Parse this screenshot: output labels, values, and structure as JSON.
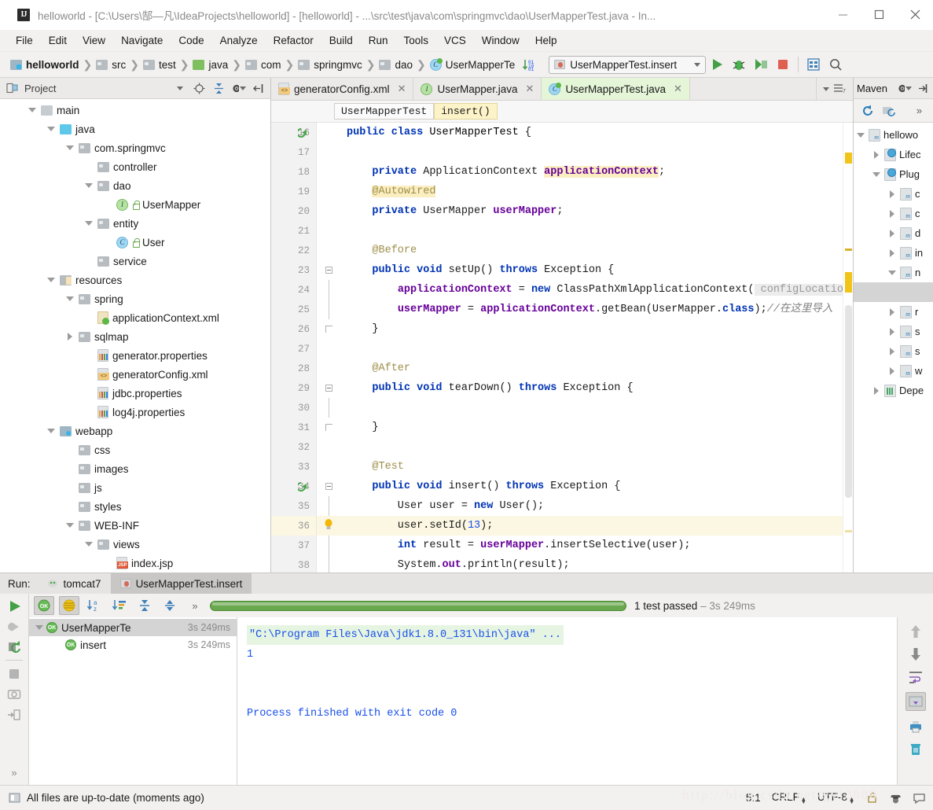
{
  "window": {
    "title": "helloworld - [C:\\Users\\郜—凡\\IdeaProjects\\helloworld] - [helloworld] - ...\\src\\test\\java\\com\\springmvc\\dao\\UserMapperTest.java - In...",
    "app_icon": "IJ",
    "minimize": "minimize-icon",
    "maximize": "maximize-icon",
    "close": "close-icon"
  },
  "menubar": {
    "items": [
      "File",
      "Edit",
      "View",
      "Navigate",
      "Code",
      "Analyze",
      "Refactor",
      "Build",
      "Run",
      "Tools",
      "VCS",
      "Window",
      "Help"
    ]
  },
  "navbar": {
    "breadcrumbs": [
      {
        "label": "helloworld",
        "icon": "module-folder-icon"
      },
      {
        "label": "src",
        "icon": "folder-icon"
      },
      {
        "label": "test",
        "icon": "folder-icon"
      },
      {
        "label": "java",
        "icon": "source-root-folder-icon"
      },
      {
        "label": "com",
        "icon": "package-icon"
      },
      {
        "label": "springmvc",
        "icon": "package-icon"
      },
      {
        "label": "dao",
        "icon": "package-icon"
      },
      {
        "label": "UserMapperTe",
        "icon": "test-class-icon"
      }
    ],
    "run_config": "UserMapperTest.insert",
    "buttons": [
      "run-button",
      "debug-button",
      "run-with-coverage-button",
      "stop-button",
      "layout-button",
      "search-button"
    ]
  },
  "project_panel": {
    "title": "Project",
    "tools": [
      "collapse-dropdown-icon",
      "locate-icon",
      "collapse-all-icon",
      "settings-gear-icon",
      "hide-panel-icon"
    ],
    "tree": [
      {
        "label": "main",
        "depth": 2,
        "arrow": "down",
        "icon": "folder-grey"
      },
      {
        "label": "java",
        "depth": 3,
        "arrow": "down",
        "icon": "folder-source"
      },
      {
        "label": "com.springmvc",
        "depth": 4,
        "arrow": "down",
        "icon": "package"
      },
      {
        "label": "controller",
        "depth": 5,
        "arrow": "none",
        "icon": "package"
      },
      {
        "label": "dao",
        "depth": 5,
        "arrow": "down",
        "icon": "package"
      },
      {
        "label": "UserMapper",
        "depth": 6,
        "arrow": "none",
        "icon": "interface"
      },
      {
        "label": "entity",
        "depth": 5,
        "arrow": "down",
        "icon": "package"
      },
      {
        "label": "User",
        "depth": 6,
        "arrow": "none",
        "icon": "class"
      },
      {
        "label": "service",
        "depth": 5,
        "arrow": "none",
        "icon": "package"
      },
      {
        "label": "resources",
        "depth": 3,
        "arrow": "down",
        "icon": "resources"
      },
      {
        "label": "spring",
        "depth": 4,
        "arrow": "down",
        "icon": "package"
      },
      {
        "label": "applicationContext.xml",
        "depth": 5,
        "arrow": "none",
        "icon": "spring-xml"
      },
      {
        "label": "sqlmap",
        "depth": 4,
        "arrow": "right",
        "icon": "package"
      },
      {
        "label": "generator.properties",
        "depth": 5,
        "arrow": "none",
        "icon": "properties"
      },
      {
        "label": "generatorConfig.xml",
        "depth": 5,
        "arrow": "none",
        "icon": "xml"
      },
      {
        "label": "jdbc.properties",
        "depth": 5,
        "arrow": "none",
        "icon": "properties"
      },
      {
        "label": "log4j.properties",
        "depth": 5,
        "arrow": "none",
        "icon": "properties"
      },
      {
        "label": "webapp",
        "depth": 3,
        "arrow": "down",
        "icon": "folder-web"
      },
      {
        "label": "css",
        "depth": 4,
        "arrow": "none",
        "icon": "folder-plain"
      },
      {
        "label": "images",
        "depth": 4,
        "arrow": "none",
        "icon": "folder-plain"
      },
      {
        "label": "js",
        "depth": 4,
        "arrow": "none",
        "icon": "folder-plain"
      },
      {
        "label": "styles",
        "depth": 4,
        "arrow": "none",
        "icon": "folder-plain"
      },
      {
        "label": "WEB-INF",
        "depth": 4,
        "arrow": "down",
        "icon": "folder-plain"
      },
      {
        "label": "views",
        "depth": 5,
        "arrow": "down",
        "icon": "folder-plain"
      },
      {
        "label": "index.jsp",
        "depth": 6,
        "arrow": "none",
        "icon": "jsp"
      }
    ]
  },
  "editor": {
    "tabs": [
      {
        "label": "generatorConfig.xml",
        "icon": "xml-file-icon",
        "active": false
      },
      {
        "label": "UserMapper.java",
        "icon": "interface-icon",
        "active": false
      },
      {
        "label": "UserMapperTest.java",
        "icon": "test-class-icon",
        "active": true
      }
    ],
    "tab_tools": [
      "tab-list-dropdown-icon"
    ],
    "breadcrumbs": [
      {
        "label": "UserMapperTest",
        "highlighted": false
      },
      {
        "label": "insert()",
        "highlighted": true
      }
    ],
    "first_line": 16,
    "lines": [
      {
        "num": 16,
        "html": "<span class=\"kw\">public class</span> <span class=\"ty\">UserMapperTest</span> {",
        "fold": "none",
        "mark": "runarrow",
        "hl": false
      },
      {
        "num": 17,
        "html": "",
        "fold": "none",
        "mark": "",
        "hl": false
      },
      {
        "num": 18,
        "html": "    <span class=\"kw\">private</span> ApplicationContext <span class=\"fld hlbg\">applicationContext</span>;",
        "fold": "none",
        "mark": "",
        "hl": false
      },
      {
        "num": 19,
        "html": "    <span class=\"an hlbg\">@Autowired</span>",
        "fold": "none",
        "mark": "",
        "hl": false
      },
      {
        "num": 20,
        "html": "    <span class=\"kw\">private</span> UserMapper <span class=\"fld\">userMapper</span>;",
        "fold": "none",
        "mark": "",
        "hl": false
      },
      {
        "num": 21,
        "html": "",
        "fold": "none",
        "mark": "",
        "hl": false
      },
      {
        "num": 22,
        "html": "    <span class=\"an\">@Before</span>",
        "fold": "none",
        "mark": "",
        "hl": false
      },
      {
        "num": 23,
        "html": "    <span class=\"kw\">public void</span> setUp() <span class=\"kw\">throws</span> Exception {",
        "fold": "start",
        "mark": "",
        "hl": false
      },
      {
        "num": 24,
        "html": "        <span class=\"fld\">applicationContext</span> = <span class=\"kw\">new</span> ClassPathXmlApplicationContext(<span class=\"param\"> configLocation:</span>",
        "fold": "line",
        "mark": "",
        "hl": false
      },
      {
        "num": 25,
        "html": "        <span class=\"fld\">userMapper</span> = <span class=\"fld\">applicationContext</span>.getBean(UserMapper.<span class=\"kw\">class</span>);<span class=\"cmt\">//在这里导入</span>",
        "fold": "line",
        "mark": "",
        "hl": false
      },
      {
        "num": 26,
        "html": "    }",
        "fold": "end",
        "mark": "",
        "hl": false
      },
      {
        "num": 27,
        "html": "",
        "fold": "none",
        "mark": "",
        "hl": false
      },
      {
        "num": 28,
        "html": "    <span class=\"an\">@After</span>",
        "fold": "none",
        "mark": "",
        "hl": false
      },
      {
        "num": 29,
        "html": "    <span class=\"kw\">public void</span> tearDown() <span class=\"kw\">throws</span> Exception {",
        "fold": "start",
        "mark": "",
        "hl": false
      },
      {
        "num": 30,
        "html": "",
        "fold": "line",
        "mark": "",
        "hl": false
      },
      {
        "num": 31,
        "html": "    }",
        "fold": "end",
        "mark": "",
        "hl": false
      },
      {
        "num": 32,
        "html": "",
        "fold": "none",
        "mark": "",
        "hl": false
      },
      {
        "num": 33,
        "html": "    <span class=\"an\">@Test</span>",
        "fold": "none",
        "mark": "",
        "hl": false
      },
      {
        "num": 34,
        "html": "    <span class=\"kw\">public void</span> insert() <span class=\"kw\">throws</span> Exception {",
        "fold": "start",
        "mark": "runtest",
        "hl": false
      },
      {
        "num": 35,
        "html": "        User user = <span class=\"kw\">new</span> User();",
        "fold": "line",
        "mark": "",
        "hl": false
      },
      {
        "num": 36,
        "html": "        user.setId(<span class=\"num\">13</span>);",
        "fold": "line",
        "mark": "bulb",
        "hl": true
      },
      {
        "num": 37,
        "html": "        <span class=\"kw\">int</span> result = <span class=\"fld\">userMapper</span>.insertSelective(user);",
        "fold": "line",
        "mark": "",
        "hl": false
      },
      {
        "num": 38,
        "html": "        System.<span class=\"fld\">out</span>.println(result);",
        "fold": "line",
        "mark": "",
        "hl": false
      }
    ]
  },
  "maven_panel": {
    "title": "Maven",
    "tools": [
      "refresh-icon",
      "download-sources-icon",
      "more-icon"
    ],
    "head_tools": [
      "settings-gear-icon",
      "hide-panel-icon"
    ],
    "tree": [
      {
        "label": "hellowo",
        "depth": 0,
        "arrow": "down",
        "icon": "maven-project",
        "sel": false
      },
      {
        "label": "Lifec",
        "depth": 1,
        "arrow": "right",
        "icon": "maven-gear",
        "sel": false
      },
      {
        "label": "Plug",
        "depth": 1,
        "arrow": "down",
        "icon": "maven-gear",
        "sel": false
      },
      {
        "label": "c",
        "depth": 2,
        "arrow": "right",
        "icon": "maven-plugin",
        "sel": false
      },
      {
        "label": "c",
        "depth": 2,
        "arrow": "right",
        "icon": "maven-plugin",
        "sel": false
      },
      {
        "label": "d",
        "depth": 2,
        "arrow": "right",
        "icon": "maven-plugin",
        "sel": false
      },
      {
        "label": "in",
        "depth": 2,
        "arrow": "right",
        "icon": "maven-plugin",
        "sel": false
      },
      {
        "label": "n",
        "depth": 2,
        "arrow": "down",
        "icon": "maven-plugin",
        "sel": false
      },
      {
        "label": "",
        "depth": 3,
        "arrow": "none",
        "icon": "none",
        "sel": true
      },
      {
        "label": "r",
        "depth": 2,
        "arrow": "right",
        "icon": "maven-plugin",
        "sel": false
      },
      {
        "label": "s",
        "depth": 2,
        "arrow": "right",
        "icon": "maven-plugin",
        "sel": false
      },
      {
        "label": "s",
        "depth": 2,
        "arrow": "right",
        "icon": "maven-plugin",
        "sel": false
      },
      {
        "label": "w",
        "depth": 2,
        "arrow": "right",
        "icon": "maven-plugin",
        "sel": false
      },
      {
        "label": "Depe",
        "depth": 1,
        "arrow": "right",
        "icon": "maven-dep",
        "sel": false
      }
    ]
  },
  "run_panel": {
    "label": "Run:",
    "tabs": [
      {
        "label": "tomcat7",
        "icon": "tomcat-icon",
        "active": false
      },
      {
        "label": "UserMapperTest.insert",
        "icon": "junit-icon",
        "active": true
      }
    ],
    "left_tools": [
      "rerun-icon",
      "rerun-failed-icon",
      "toggle-auto-test-icon",
      "stop-icon",
      "dump-threads-icon",
      "export-icon",
      "more-icon"
    ],
    "toolbar": [
      "show-passed-icon",
      "show-ignored-icon",
      "sort-alphabetically-icon",
      "sort-by-duration-icon",
      "expand-all-icon",
      "collapse-all-icon",
      "more-icon"
    ],
    "status": {
      "text": "1 test passed",
      "duration": "3s 249ms",
      "progress_percent": 100,
      "color": "#6aa84f"
    },
    "tests": [
      {
        "label": "UserMapperTe",
        "duration": "3s 249ms",
        "status": "passed",
        "selected": true,
        "depth": 0
      },
      {
        "label": "insert",
        "duration": "3s 249ms",
        "status": "passed",
        "selected": false,
        "depth": 1
      }
    ],
    "console": [
      {
        "text": "\"C:\\Program Files\\Java\\jdk1.8.0_131\\bin\\java\" ...",
        "style": "cmd"
      },
      {
        "text": "1",
        "style": "out"
      },
      {
        "text": "",
        "style": "out"
      },
      {
        "text": "",
        "style": "out"
      },
      {
        "text": "Process finished with exit code 0",
        "style": "out"
      }
    ],
    "right_tools": [
      "scroll-up-icon",
      "scroll-down-icon",
      "soft-wrap-icon",
      "scroll-to-end-icon",
      "print-icon",
      "clear-all-icon"
    ]
  },
  "statusbar": {
    "message": "All files are up-to-date (moments ago)",
    "caret_position": "5:1",
    "line_separator": "CRLF",
    "encoding": "UTF-8",
    "lock_icon": "unlocked-icon",
    "hector_icon": "hector-icon",
    "event_log_icon": "event-log-icon",
    "watermark": "http://blog.csdn.net/gyf8888"
  }
}
